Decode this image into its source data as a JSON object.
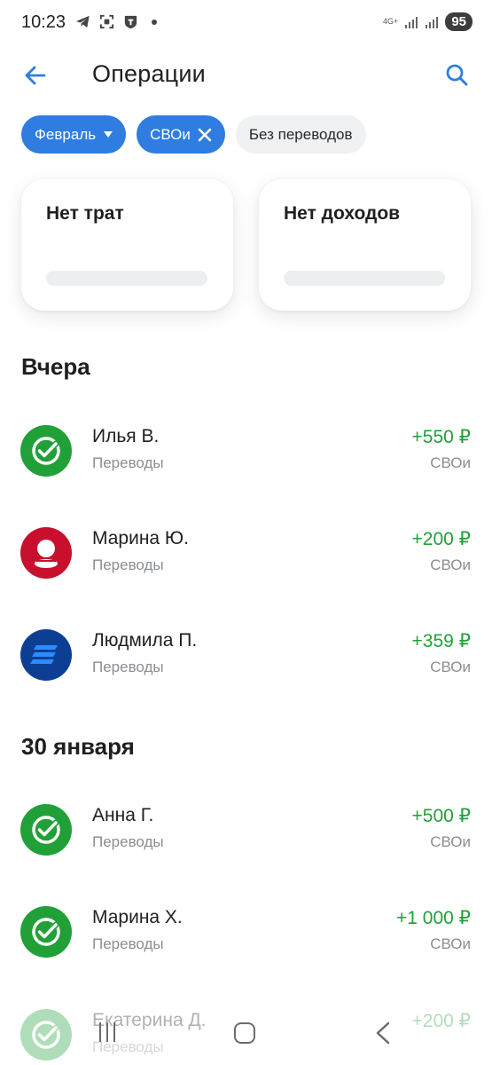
{
  "status_bar": {
    "time": "10:23",
    "network": "4G+",
    "battery": "95"
  },
  "header": {
    "title": "Операции",
    "back_icon": "arrow-left-icon",
    "search_icon": "search-icon"
  },
  "filters": {
    "month": "Февраль",
    "source": "СВОи",
    "without_transfers": "Без переводов"
  },
  "summary": {
    "spend_title": "Нет трат",
    "income_title": "Нет доходов"
  },
  "sections": [
    {
      "title": "Вчера",
      "transactions": [
        {
          "name": "Илья В.",
          "category": "Переводы",
          "amount": "+550 ₽",
          "source": "СВОи",
          "avatar": "sber-check-icon"
        },
        {
          "name": "Марина Ю.",
          "category": "Переводы",
          "amount": "+200 ₽",
          "source": "СВОи",
          "avatar": "person-icon"
        },
        {
          "name": "Людмила П.",
          "category": "Переводы",
          "amount": "+359 ₽",
          "source": "СВОи",
          "avatar": "bank-stripes-icon"
        }
      ]
    },
    {
      "title": "30 января",
      "transactions": [
        {
          "name": "Анна Г.",
          "category": "Переводы",
          "amount": "+500 ₽",
          "source": "СВОи",
          "avatar": "sber-check-icon"
        },
        {
          "name": "Марина Х.",
          "category": "Переводы",
          "amount": "+1 000 ₽",
          "source": "СВОи",
          "avatar": "sber-check-icon"
        },
        {
          "name": "Екатерина Д.",
          "category": "Переводы",
          "amount": "+200 ₽",
          "source": "",
          "avatar": "sber-check-icon"
        }
      ]
    }
  ],
  "colors": {
    "accent": "#2f7de0",
    "income": "#21a038",
    "sber_green": "#21a038",
    "avatar_red": "#c8102e",
    "avatar_navy": "#0c3f94"
  }
}
